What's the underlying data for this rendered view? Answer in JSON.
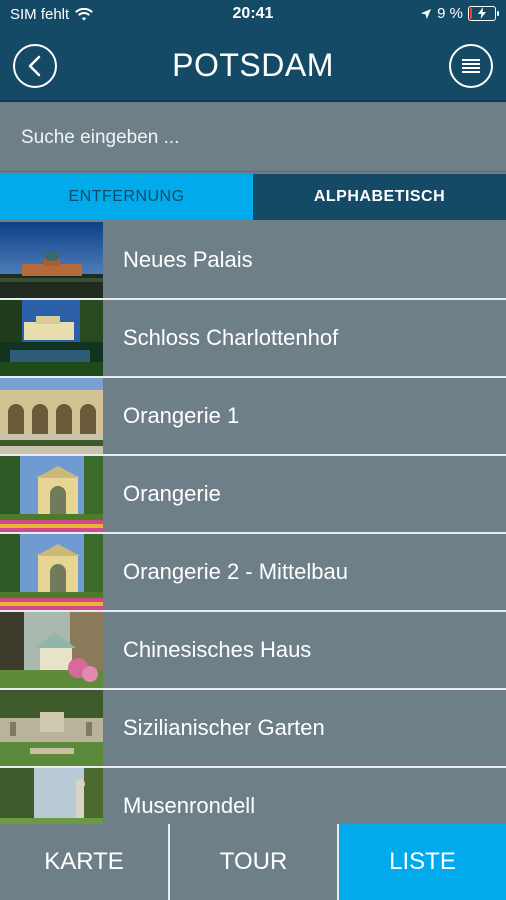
{
  "status_bar": {
    "carrier": "SIM fehlt",
    "time": "20:41",
    "battery_text": "9 %",
    "battery_level": 0.09
  },
  "header": {
    "title": "POTSDAM",
    "back_icon": "chevron-left-icon",
    "menu_icon": "list-menu-icon"
  },
  "search": {
    "placeholder": "Suche eingeben ..."
  },
  "sort_tabs": [
    {
      "label": "ENTFERNUNG",
      "active": true
    },
    {
      "label": "ALPHABETISCH",
      "active": false
    }
  ],
  "places": [
    {
      "name": "Neues Palais"
    },
    {
      "name": "Schloss Charlottenhof"
    },
    {
      "name": "Orangerie 1"
    },
    {
      "name": "Orangerie"
    },
    {
      "name": "Orangerie 2 - Mittelbau"
    },
    {
      "name": "Chinesisches Haus"
    },
    {
      "name": "Sizilianischer Garten"
    },
    {
      "name": "Musenrondell"
    }
  ],
  "bottom_tabs": [
    {
      "label": "KARTE",
      "active": false
    },
    {
      "label": "TOUR",
      "active": false
    },
    {
      "label": "LISTE",
      "active": true
    }
  ],
  "colors": {
    "primary": "#154a66",
    "accent": "#00aaeb",
    "row_bg": "#6e7f88"
  }
}
